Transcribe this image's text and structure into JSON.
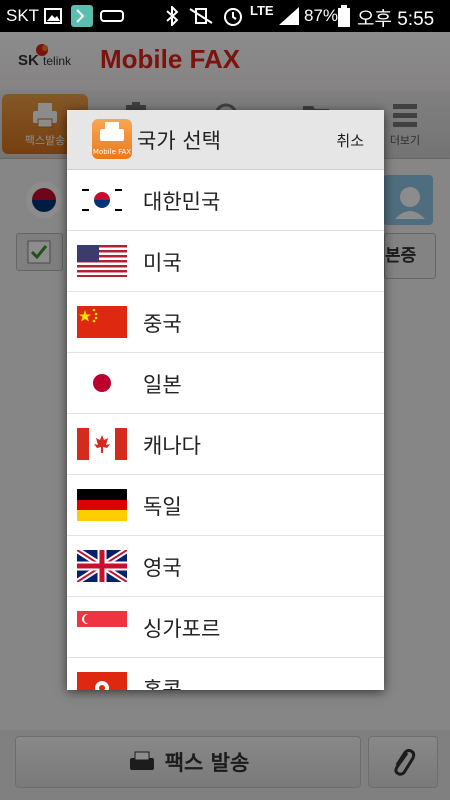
{
  "status_bar": {
    "carrier": "SKT",
    "network": "LTE",
    "battery": "87%",
    "time": "오후 5:55"
  },
  "app": {
    "title": "Mobile FAX",
    "brand_sk": "SK",
    "brand_telink": "telink"
  },
  "tabs": [
    {
      "label": "팩스발송",
      "active": true
    },
    {
      "label": "",
      "active": false
    },
    {
      "label": "",
      "active": false
    },
    {
      "label": "",
      "active": false
    },
    {
      "label": "더보기",
      "active": false
    }
  ],
  "background": {
    "partial_button_text": "본증",
    "send_button_label": "팩스 발송"
  },
  "dialog": {
    "icon_text": "Mobile FAX",
    "title": "국가 선택",
    "cancel_label": "취소",
    "countries": [
      {
        "name": "대한민국",
        "flag": "korea-flag-icon"
      },
      {
        "name": "미국",
        "flag": "usa-flag-icon"
      },
      {
        "name": "중국",
        "flag": "china-flag-icon"
      },
      {
        "name": "일본",
        "flag": "japan-flag-icon"
      },
      {
        "name": "캐나다",
        "flag": "canada-flag-icon"
      },
      {
        "name": "독일",
        "flag": "germany-flag-icon"
      },
      {
        "name": "영국",
        "flag": "uk-flag-icon"
      },
      {
        "name": "싱가포르",
        "flag": "singapore-flag-icon"
      },
      {
        "name": "홍콩",
        "flag": "hongkong-flag-icon"
      }
    ]
  },
  "colors": {
    "brand_red": "#e2231a",
    "tab_active": "#e08a30"
  }
}
